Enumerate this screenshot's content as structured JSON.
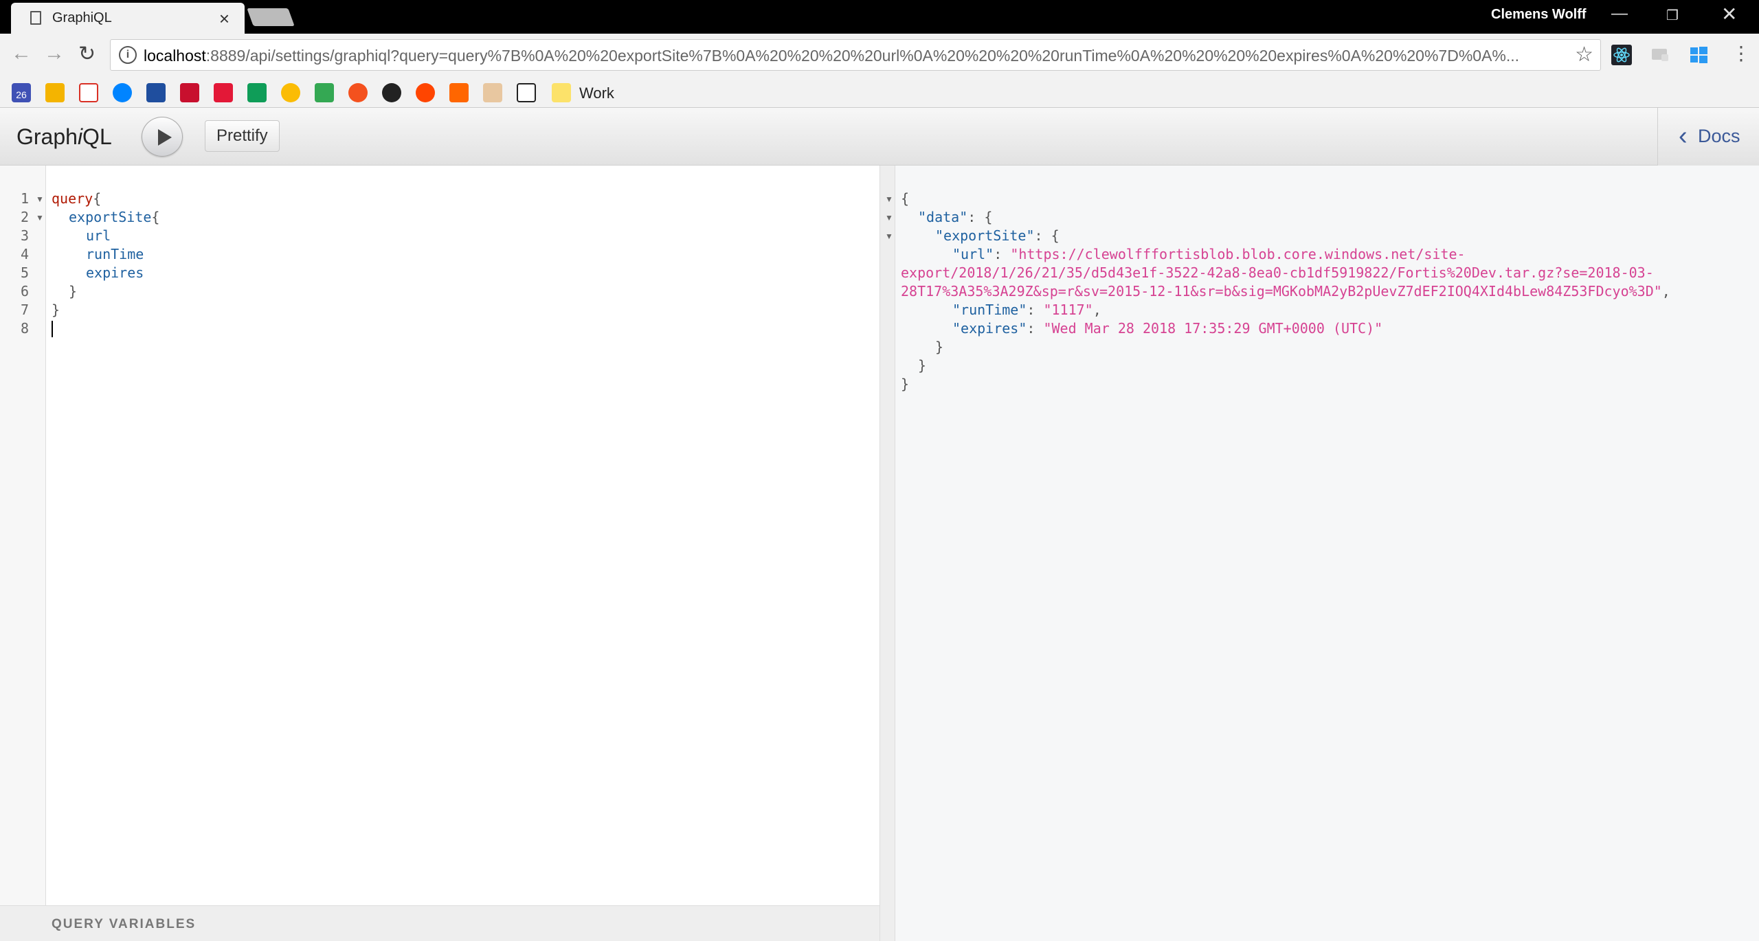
{
  "browser": {
    "tab_title": "GraphiQL",
    "user_name": "Clemens Wolff",
    "url_host": "localhost",
    "url_rest": ":8889/api/settings/graphiql?query=query%7B%0A%20%20exportSite%7B%0A%20%20%20%20url%0A%20%20%20%20runTime%0A%20%20%20%20expires%0A%20%20%7D%0A%...",
    "bookmark_work": "Work",
    "calendar_day": "26"
  },
  "graphiql": {
    "title_a": "Graph",
    "title_i": "i",
    "title_b": "QL",
    "prettify_label": "Prettify",
    "docs_label": "Docs",
    "query_variables_label": "QUERY VARIABLES"
  },
  "query_lines": [
    "1",
    "2",
    "3",
    "4",
    "5",
    "6",
    "7",
    "8"
  ],
  "query": {
    "l1_kw": "query",
    "l1_p": "{",
    "l2_f": "exportSite",
    "l2_p": "{",
    "l3": "url",
    "l4": "runTime",
    "l5": "expires",
    "l6": "}",
    "l7": "}"
  },
  "result": {
    "open": "{",
    "data_key": "\"data\"",
    "export_key": "\"exportSite\"",
    "url_key": "\"url\"",
    "url_val_1": "\"https://clewolfffortisblob.blob.core.windows.net/site-",
    "url_val_2": "export/2018/1/26/21/35/d5d43e1f-3522-42a8-8ea0-cb1df5919822/Fortis%20Dev.tar.gz?se=2018-03-",
    "url_val_3": "28T17%3A35%3A29Z&sp=r&sv=2015-12-11&sr=b&sig=MGKobMA2yB2pUevZ7dEF2IOQ4XId4bLew84Z53FDcyo%3D\"",
    "runtime_key": "\"runTime\"",
    "runtime_val": "\"1117\"",
    "expires_key": "\"expires\"",
    "expires_val": "\"Wed Mar 28 2018 17:35:29 GMT+0000 (UTC)\""
  }
}
